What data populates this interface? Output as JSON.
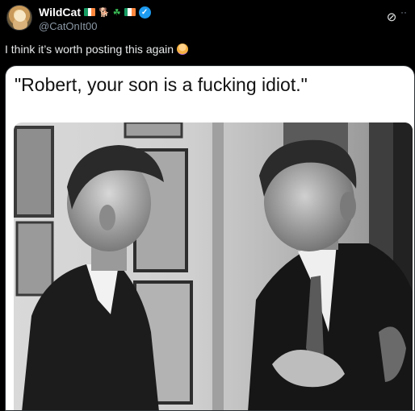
{
  "post": {
    "display_name": "WildCat",
    "handle": "@CatOnIt00",
    "text": "I think it’s worth posting this again",
    "text_emoji": "person-shrugging-emoji",
    "badges": [
      "ireland-flag",
      "dog-icon",
      "shamrock-icon",
      "ireland-flag",
      "verified-badge"
    ],
    "verified_mark": "✓",
    "grok_symbol": "⊘",
    "more_symbol": "··"
  },
  "media": {
    "caption": "\"Robert, your son is a fucking idiot.\"",
    "image_kind": "black-and-white-photo"
  },
  "colors": {
    "background": "#000000",
    "verified": "#1d9bf0",
    "handle_text": "#8b98a5",
    "flag_green": "#169b62",
    "flag_white": "#ffffff",
    "flag_orange": "#ff883e"
  }
}
